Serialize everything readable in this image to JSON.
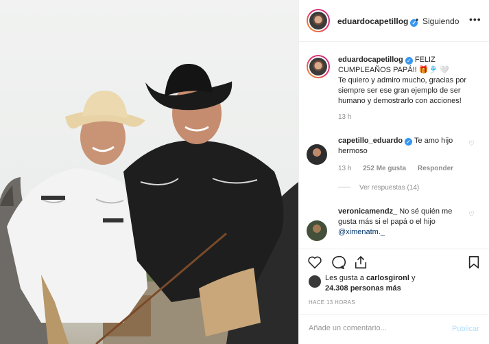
{
  "post": {
    "image_alt": "Photo of two men in cowboy hats on horseback"
  },
  "header": {
    "username": "eduardocapetillog",
    "separator": "•",
    "follow_status": "Siguiendo",
    "more": "•••"
  },
  "caption": {
    "username": "eduardocapetillog",
    "text_line1": "FELIZ CUMPLEAÑOS PAPÁ!! 🎁🎐 🤍",
    "text_line2": "Te quiero y admiro mucho, gracias por siempre ser ese gran ejemplo de ser humano y demostrarlo con acciones!",
    "time": "13 h"
  },
  "comments": [
    {
      "username": "capetillo_eduardo",
      "text": "Te amo hijo hermoso",
      "time": "13 h",
      "likes": "252 Me gusta",
      "reply": "Responder",
      "view_replies": "Ver respuestas (14)"
    },
    {
      "username": "veronicamendz_",
      "text": "No sé quién me gusta más si el papá o el hijo",
      "mention": "@ximenatm._"
    }
  ],
  "likes": {
    "prefix": "Les gusta a",
    "user": "carlosgironl",
    "conj": "y",
    "count": "24.308 personas más"
  },
  "time_ago": "HACE 13 HORAS",
  "add_comment": {
    "placeholder": "Añade un comentario...",
    "publish": "Publicar"
  },
  "colors": {
    "link_blue": "#3897f0",
    "muted": "#8e8e8e",
    "publish_disabled": "#b2dffc"
  },
  "icons": [
    "verified-badge-icon",
    "heart-icon",
    "comment-icon",
    "share-icon",
    "bookmark-icon",
    "more-options-icon"
  ]
}
